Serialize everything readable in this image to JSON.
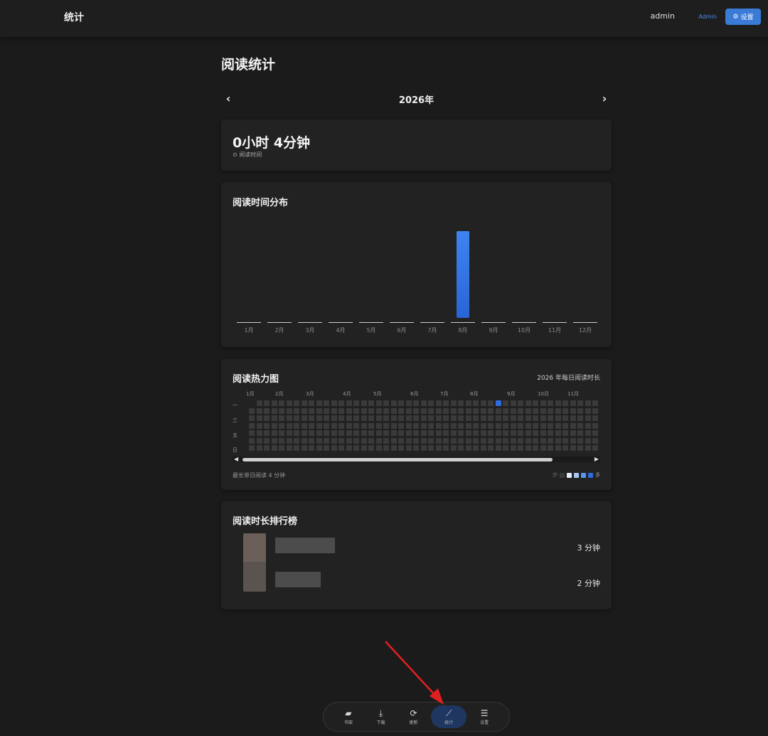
{
  "topbar": {
    "title": "统计",
    "user": "admin",
    "role": "Admin",
    "settings_label": "设置"
  },
  "page": {
    "heading": "阅读统计"
  },
  "year_nav": {
    "year": "2026年",
    "prev": "‹",
    "next": "›"
  },
  "total": {
    "value": "0小时 4分钟",
    "label": "阅读时间",
    "icon": "clock-icon"
  },
  "distribution": {
    "title": "阅读时间分布",
    "chart_data": {
      "type": "bar",
      "categories": [
        "1月",
        "2月",
        "3月",
        "4月",
        "5月",
        "6月",
        "7月",
        "8月",
        "9月",
        "10月",
        "11月",
        "12月"
      ],
      "values": [
        0,
        0,
        0,
        0,
        0,
        0,
        0,
        4,
        0,
        0,
        0,
        0
      ],
      "title": "阅读时间分布",
      "accent": "#3d84f0"
    }
  },
  "heatmap": {
    "title": "阅读热力图",
    "caption": "2026 年每日阅读时长",
    "months": [
      "1月",
      "2月",
      "3月",
      "4月",
      "5月",
      "6月",
      "7月",
      "8月",
      "9月",
      "10月",
      "11月"
    ],
    "days": [
      "一",
      "三",
      "五",
      "日"
    ],
    "footer": "最长单日阅读 4 分钟",
    "legend_less": "少",
    "legend_more": "多",
    "legend_colors": [
      "#3a3a3a",
      "#e8eef8",
      "#a8c6f5",
      "#5b95ee",
      "#2f6be0"
    ],
    "active_color": "#2f6be0"
  },
  "ranking": {
    "title": "阅读时长排行榜",
    "items": [
      {
        "minutes": "3 分钟"
      },
      {
        "minutes": "2 分钟"
      }
    ]
  },
  "bottom_nav": {
    "items": [
      {
        "label": "书架",
        "icon": "book-icon",
        "glyph": "▰"
      },
      {
        "label": "下载",
        "icon": "download-icon",
        "glyph": "⤓"
      },
      {
        "label": "更新",
        "icon": "refresh-icon",
        "glyph": "⟳"
      },
      {
        "label": "统计",
        "icon": "chart-icon",
        "glyph": "⟋"
      },
      {
        "label": "设置",
        "icon": "sliders-icon",
        "glyph": "☰"
      }
    ]
  },
  "colors": {
    "annotation_arrow": "#e02020",
    "accent": "#3a7bd5"
  }
}
